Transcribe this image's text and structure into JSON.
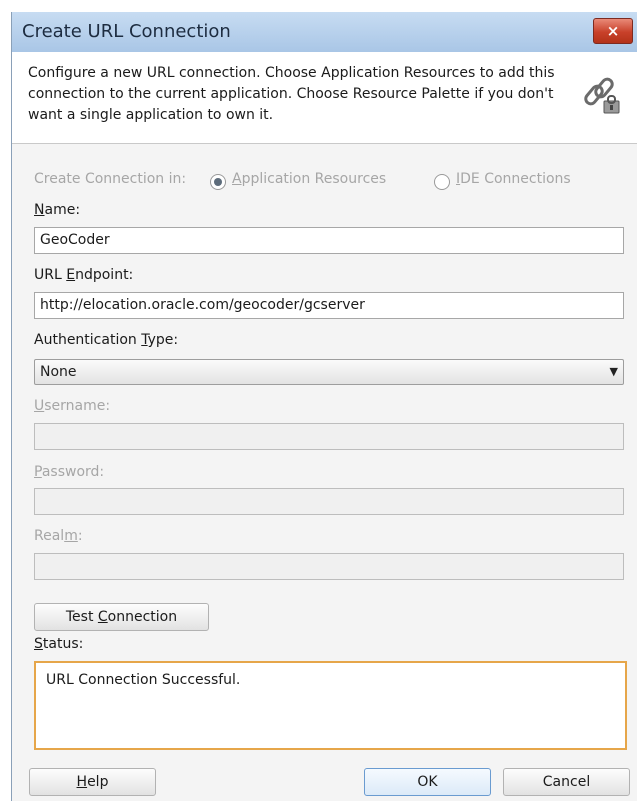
{
  "dialog": {
    "title": "Create URL Connection",
    "close_symbol": "×",
    "description": "Configure a new URL connection.  Choose Application Resources to add this connection to the current application. Choose Resource Palette if you don't want a single application to own it.",
    "header_icon": "connection-link-icon"
  },
  "create_in": {
    "label": "Create Connection in:",
    "options": [
      {
        "pre": "",
        "key": "A",
        "post": "pplication Resources",
        "selected": true,
        "enabled": false
      },
      {
        "pre": "",
        "key": "I",
        "post": "DE Connections",
        "selected": false,
        "enabled": false
      }
    ]
  },
  "name": {
    "label_pre": "",
    "label_key": "N",
    "label_post": "ame:",
    "value": "GeoCoder"
  },
  "url": {
    "label_pre": "URL ",
    "label_key": "E",
    "label_post": "ndpoint:",
    "value": "http://elocation.oracle.com/geocoder/gcserver"
  },
  "auth": {
    "label_pre": "Authentication ",
    "label_key": "T",
    "label_post": "ype:",
    "value": "None",
    "arrow": "▼"
  },
  "username": {
    "label_pre": "",
    "label_key": "U",
    "label_post": "sername:",
    "value": "",
    "enabled": false
  },
  "password": {
    "label_pre": "",
    "label_key": "P",
    "label_post": "assword:",
    "value": "",
    "enabled": false
  },
  "realm": {
    "label_pre": "Real",
    "label_key": "m",
    "label_post": ":",
    "value": "",
    "enabled": false
  },
  "test_button": {
    "pre": "Test ",
    "key": "C",
    "post": "onnection"
  },
  "status": {
    "label_pre": "",
    "label_key": "S",
    "label_post": "tatus:",
    "text": "URL Connection Successful.",
    "border_color": "#e6a64a"
  },
  "footer": {
    "help": {
      "pre": "",
      "key": "H",
      "post": "elp"
    },
    "ok": "OK",
    "cancel": "Cancel"
  },
  "colors": {
    "titlebar": "#b8d0ec",
    "close": "#c8412a",
    "disabled_text": "#a6a6a6"
  }
}
